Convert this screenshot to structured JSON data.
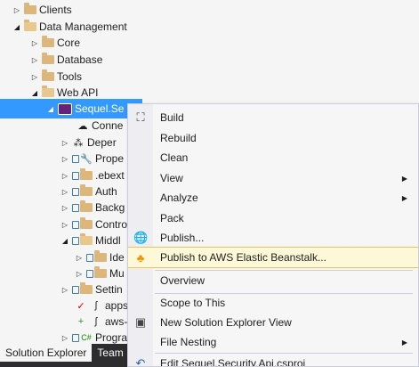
{
  "tree": {
    "items": [
      {
        "label": "Clients"
      },
      {
        "label": "Data Management"
      },
      {
        "label": "Core"
      },
      {
        "label": "Database"
      },
      {
        "label": "Tools"
      },
      {
        "label": "Web API"
      },
      {
        "label": "Sequel.Se"
      },
      {
        "label": "Conne"
      },
      {
        "label": "Deper"
      },
      {
        "label": "Prope"
      },
      {
        "label": ".ebext"
      },
      {
        "label": "Auth"
      },
      {
        "label": "Backg"
      },
      {
        "label": "Contro"
      },
      {
        "label": "Middl"
      },
      {
        "label": "Ide"
      },
      {
        "label": "Mu"
      },
      {
        "label": "Settin"
      },
      {
        "label": "appse"
      },
      {
        "label": "aws-b"
      },
      {
        "label": "Progra"
      }
    ]
  },
  "tabs": {
    "solution_explorer": "Solution Explorer",
    "team": "Team"
  },
  "menu": {
    "items": [
      {
        "label": "Build",
        "icon": "build-icon"
      },
      {
        "label": "Rebuild"
      },
      {
        "label": "Clean"
      },
      {
        "label": "View",
        "submenu": true
      },
      {
        "label": "Analyze",
        "submenu": true
      },
      {
        "label": "Pack"
      },
      {
        "label": "Publish...",
        "icon": "globe-publish-icon"
      },
      {
        "label": "Publish to AWS Elastic Beanstalk...",
        "icon": "aws-beanstalk-icon",
        "highlighted": true
      },
      {
        "label": "Overview"
      },
      {
        "label": "Scope to This"
      },
      {
        "label": "New Solution Explorer View",
        "icon": "new-view-icon"
      },
      {
        "label": "File Nesting",
        "submenu": true
      },
      {
        "label": "Edit Sequel.Security.Api.csproj",
        "icon": "edit-icon"
      }
    ]
  },
  "colors": {
    "selection": "#3399ff",
    "highlight_bg": "#fcf8d8",
    "highlight_border": "#e5c365",
    "folder": "#dcb67a"
  }
}
